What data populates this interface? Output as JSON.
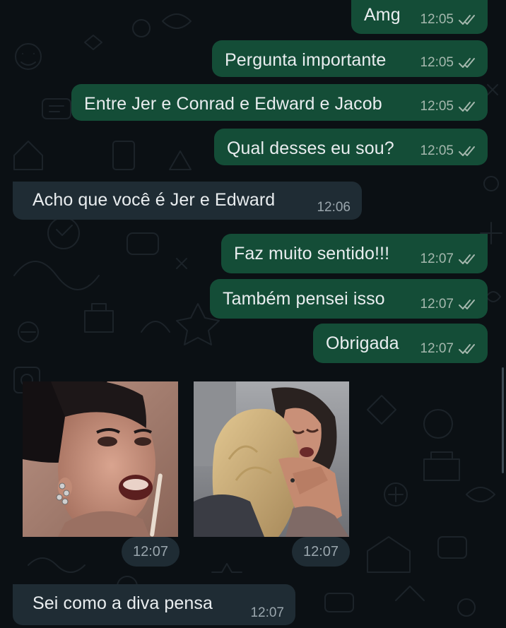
{
  "messages": [
    {
      "text": "Amg",
      "time": "12:05",
      "dir": "out"
    },
    {
      "text": "Pergunta importante",
      "time": "12:05",
      "dir": "out"
    },
    {
      "text": "Entre Jer e Conrad e Edward e Jacob",
      "time": "12:05",
      "dir": "out"
    },
    {
      "text": "Qual desses eu sou?",
      "time": "12:05",
      "dir": "out"
    },
    {
      "text": "Acho que você é Jer e Edward",
      "time": "12:06",
      "dir": "in"
    },
    {
      "text": "Faz muito sentido!!!",
      "time": "12:07",
      "dir": "out"
    },
    {
      "text": "Também pensei isso",
      "time": "12:07",
      "dir": "out"
    },
    {
      "text": "Obrigada",
      "time": "12:07",
      "dir": "out"
    },
    {
      "text": "Sei como a diva pensa",
      "time": "12:07",
      "dir": "in"
    }
  ],
  "stickers": [
    {
      "time": "12:07",
      "description": "woman-applying-lip-gloss"
    },
    {
      "time": "12:07",
      "description": "two-women-hugging-crying"
    }
  ],
  "colors": {
    "background": "#0b1014",
    "outgoing_bubble": "#144d37",
    "incoming_bubble": "#1f2c34",
    "text": "#e9edef",
    "meta": "#a5b8ae"
  }
}
